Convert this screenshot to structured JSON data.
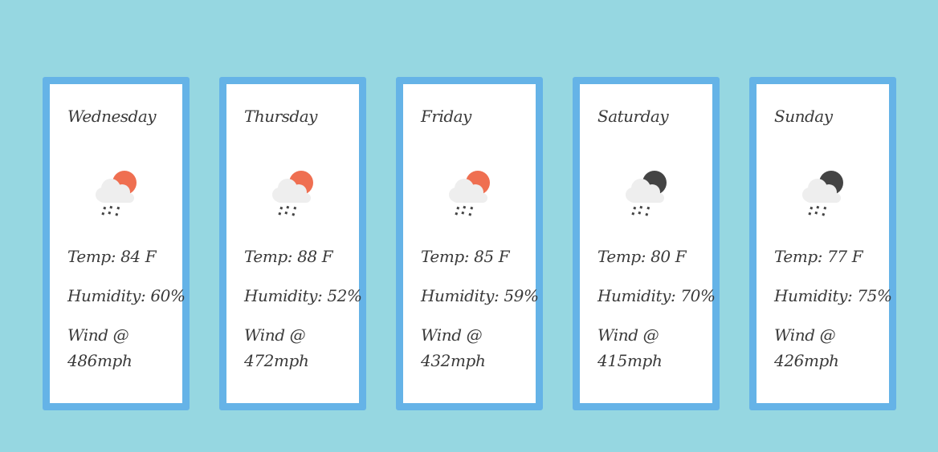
{
  "colors": {
    "background": "#96d7e1",
    "card_border": "#65b3e7",
    "sun": "#ef6f51",
    "moon": "#444444",
    "cloud": "#eeeeee",
    "rain": "#444444"
  },
  "forecast": [
    {
      "day": "Wednesday",
      "icon": "rain-sun-icon",
      "temp": "Temp: 84 F",
      "humidity": "Humidity: 60%",
      "wind_label": "Wind @",
      "wind_value": "486mph"
    },
    {
      "day": "Thursday",
      "icon": "rain-sun-icon",
      "temp": "Temp: 88 F",
      "humidity": "Humidity: 52%",
      "wind_label": "Wind @",
      "wind_value": "472mph"
    },
    {
      "day": "Friday",
      "icon": "rain-sun-icon",
      "temp": "Temp: 85 F",
      "humidity": "Humidity: 59%",
      "wind_label": "Wind @",
      "wind_value": "432mph"
    },
    {
      "day": "Saturday",
      "icon": "rain-moon-icon",
      "temp": "Temp: 80 F",
      "humidity": "Humidity: 70%",
      "wind_label": "Wind @",
      "wind_value": "415mph"
    },
    {
      "day": "Sunday",
      "icon": "rain-moon-icon",
      "temp": "Temp: 77 F",
      "humidity": "Humidity: 75%",
      "wind_label": "Wind @",
      "wind_value": "426mph"
    }
  ]
}
